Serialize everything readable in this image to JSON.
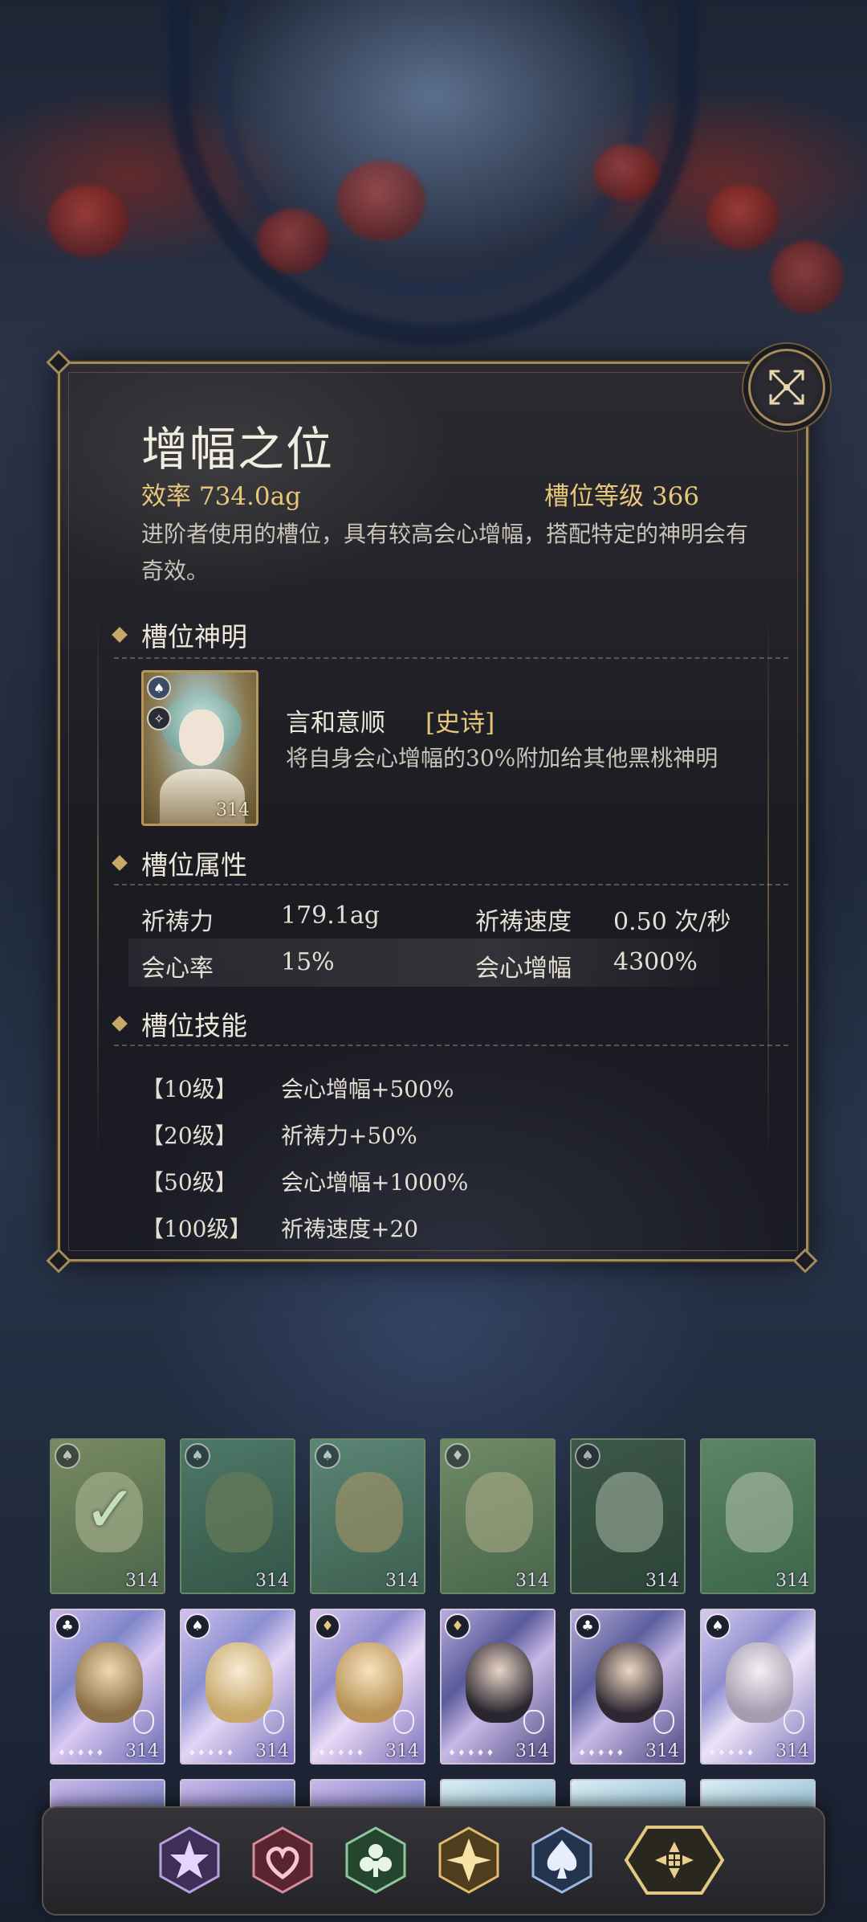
{
  "dialog": {
    "title": "增幅之位",
    "efficiency": "效率 734.0ag",
    "slot_level": "槽位等级 366",
    "description": "进阶者使用的槽位，具有较高会心增幅，搭配特定的神明会有奇效。",
    "close_icon": "crossed-swords-close-icon",
    "sections": {
      "god": "槽位神明",
      "attributes": "槽位属性",
      "skills": "槽位技能"
    },
    "god": {
      "name": "言和意顺",
      "rarity": "[史诗]",
      "effect": "将自身会心增幅的30%附加给其他黑桃神明",
      "level": "314"
    },
    "attributes": [
      {
        "label": "祈祷力",
        "value": "179.1ag",
        "label2": "祈祷速度",
        "value2": "0.50 次/秒"
      },
      {
        "label": "会心率",
        "value": "15%",
        "label2": "会心增幅",
        "value2": "4300%"
      }
    ],
    "skills": [
      {
        "level": "【10级】",
        "effect": "会心增幅+500%"
      },
      {
        "level": "【20级】",
        "effect": "祈祷力+50%"
      },
      {
        "level": "【50级】",
        "effect": "会心增幅+1000%"
      },
      {
        "level": "【100级】",
        "effect": "祈祷速度+20"
      }
    ]
  },
  "cards": {
    "row1": [
      "314",
      "314",
      "314",
      "314",
      "314",
      "314"
    ],
    "row2": [
      "314",
      "314",
      "314",
      "314",
      "314",
      "314"
    ]
  },
  "bottom_nav": [
    "star-suit-icon",
    "heart-suit-icon",
    "club-suit-icon",
    "diamond-suit-icon",
    "spade-suit-icon",
    "all-suits-icon"
  ],
  "colors": {
    "gold": "#e7c77a",
    "frame": "#a58a5c"
  }
}
